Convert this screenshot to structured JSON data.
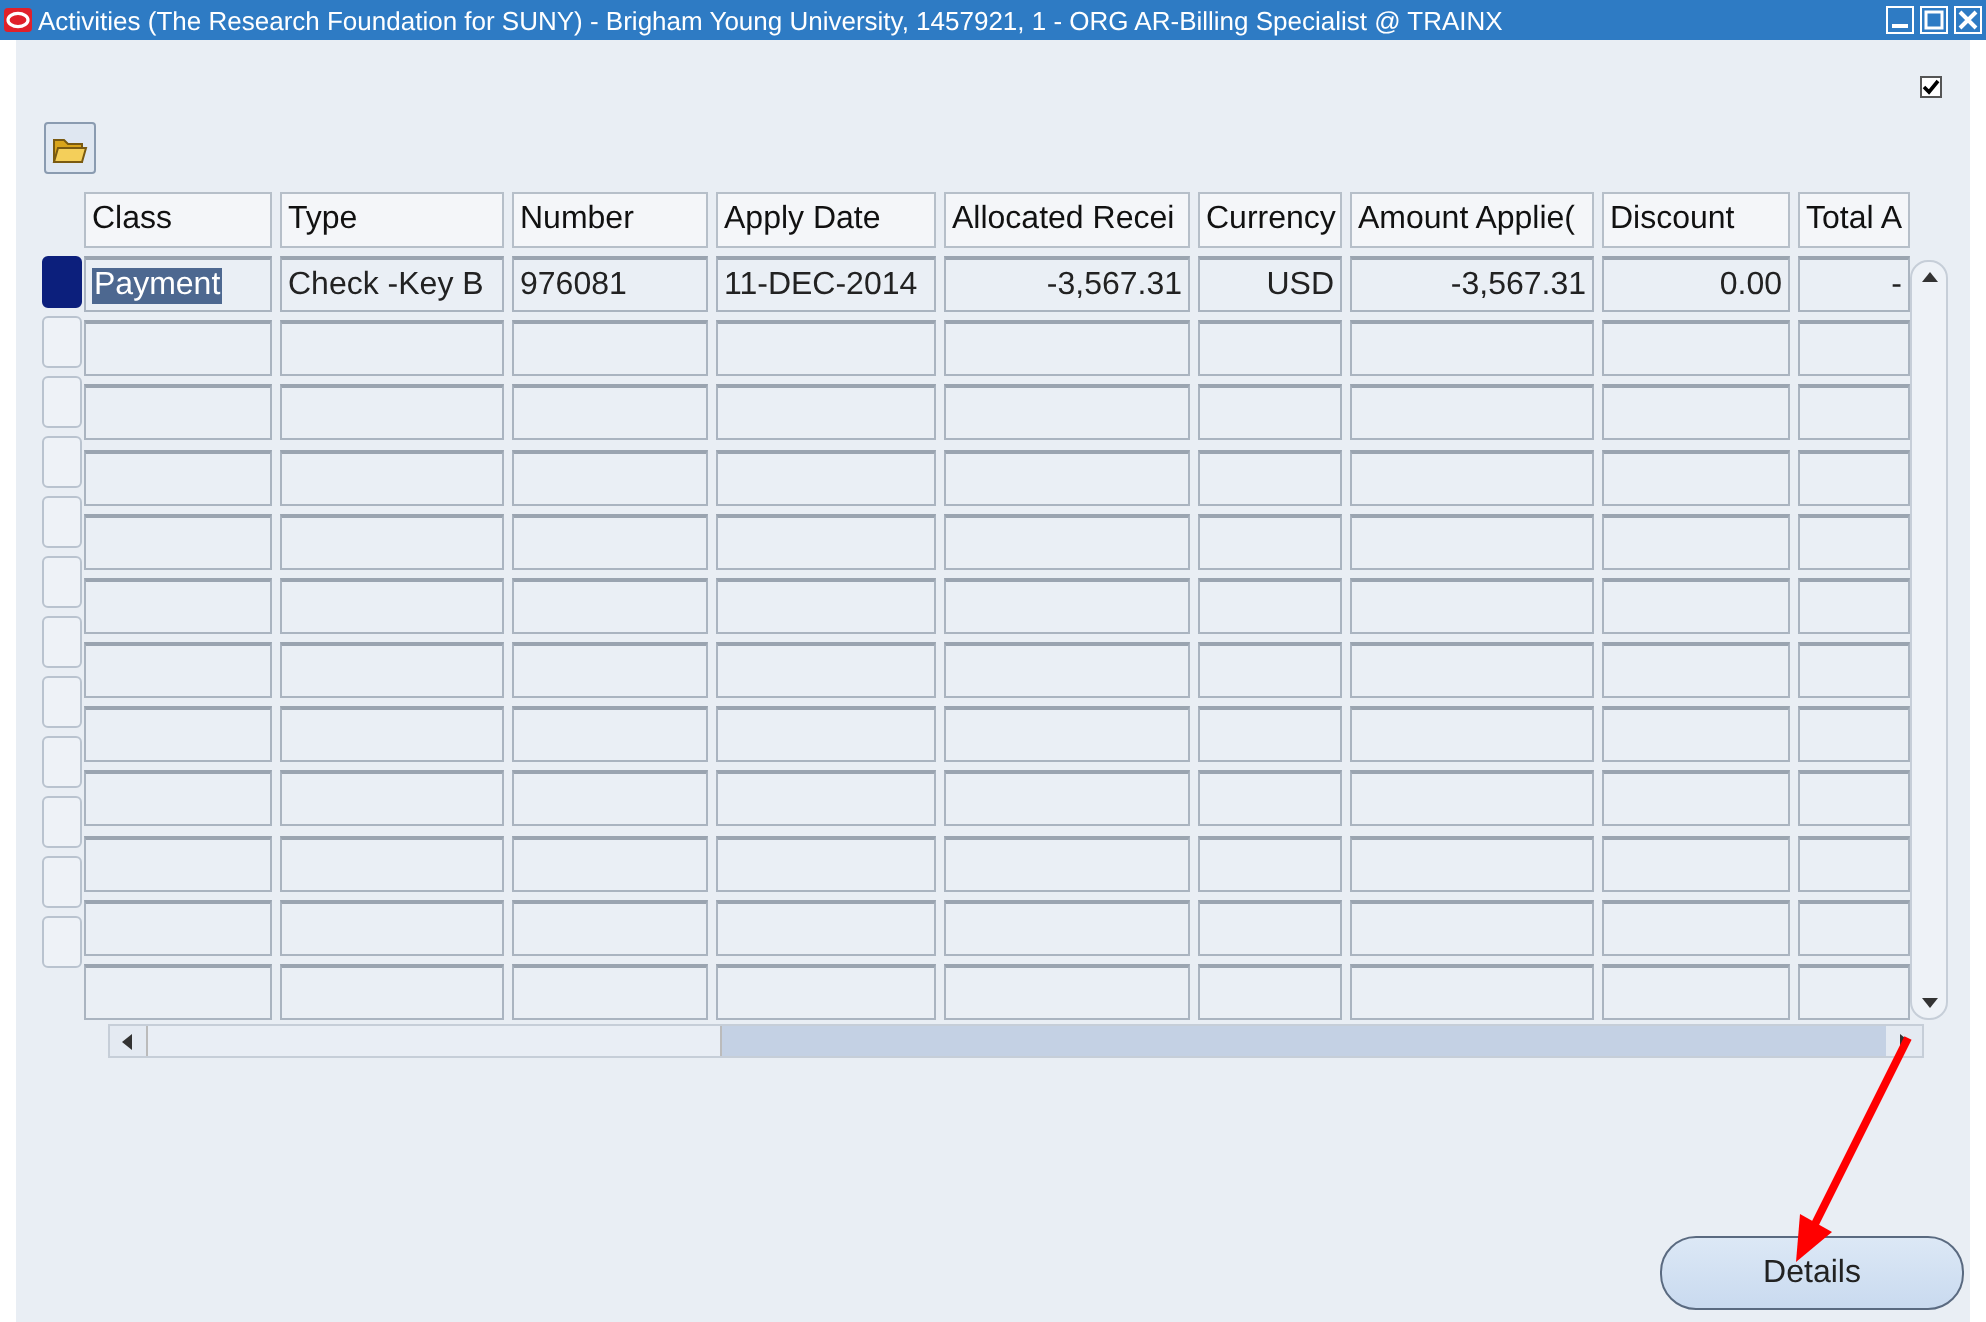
{
  "window": {
    "title": "Activities (The Research Foundation for SUNY) - Brigham Young University, 1457921, 1 - ORG AR-Billing Specialist @ TRAINX"
  },
  "top_checkbox": {
    "checked": true
  },
  "table": {
    "columns": [
      "Class",
      "Type",
      "Number",
      "Apply Date",
      "Allocated Recei",
      "Currency",
      "Amount Applie(",
      "Discount",
      "Total A"
    ],
    "rows": [
      {
        "selected": true,
        "cells": [
          "Payment",
          "Check -Key B",
          "976081",
          "11-DEC-2014",
          "-3,567.31",
          "USD",
          "-3,567.31",
          "0.00",
          "-"
        ]
      },
      {
        "selected": false
      },
      {
        "selected": false
      },
      {
        "selected": false
      },
      {
        "selected": false
      },
      {
        "selected": false
      },
      {
        "selected": false
      },
      {
        "selected": false
      },
      {
        "selected": false
      },
      {
        "selected": false
      },
      {
        "selected": false
      },
      {
        "selected": false
      }
    ]
  },
  "buttons": [
    {
      "label": "Details"
    }
  ]
}
